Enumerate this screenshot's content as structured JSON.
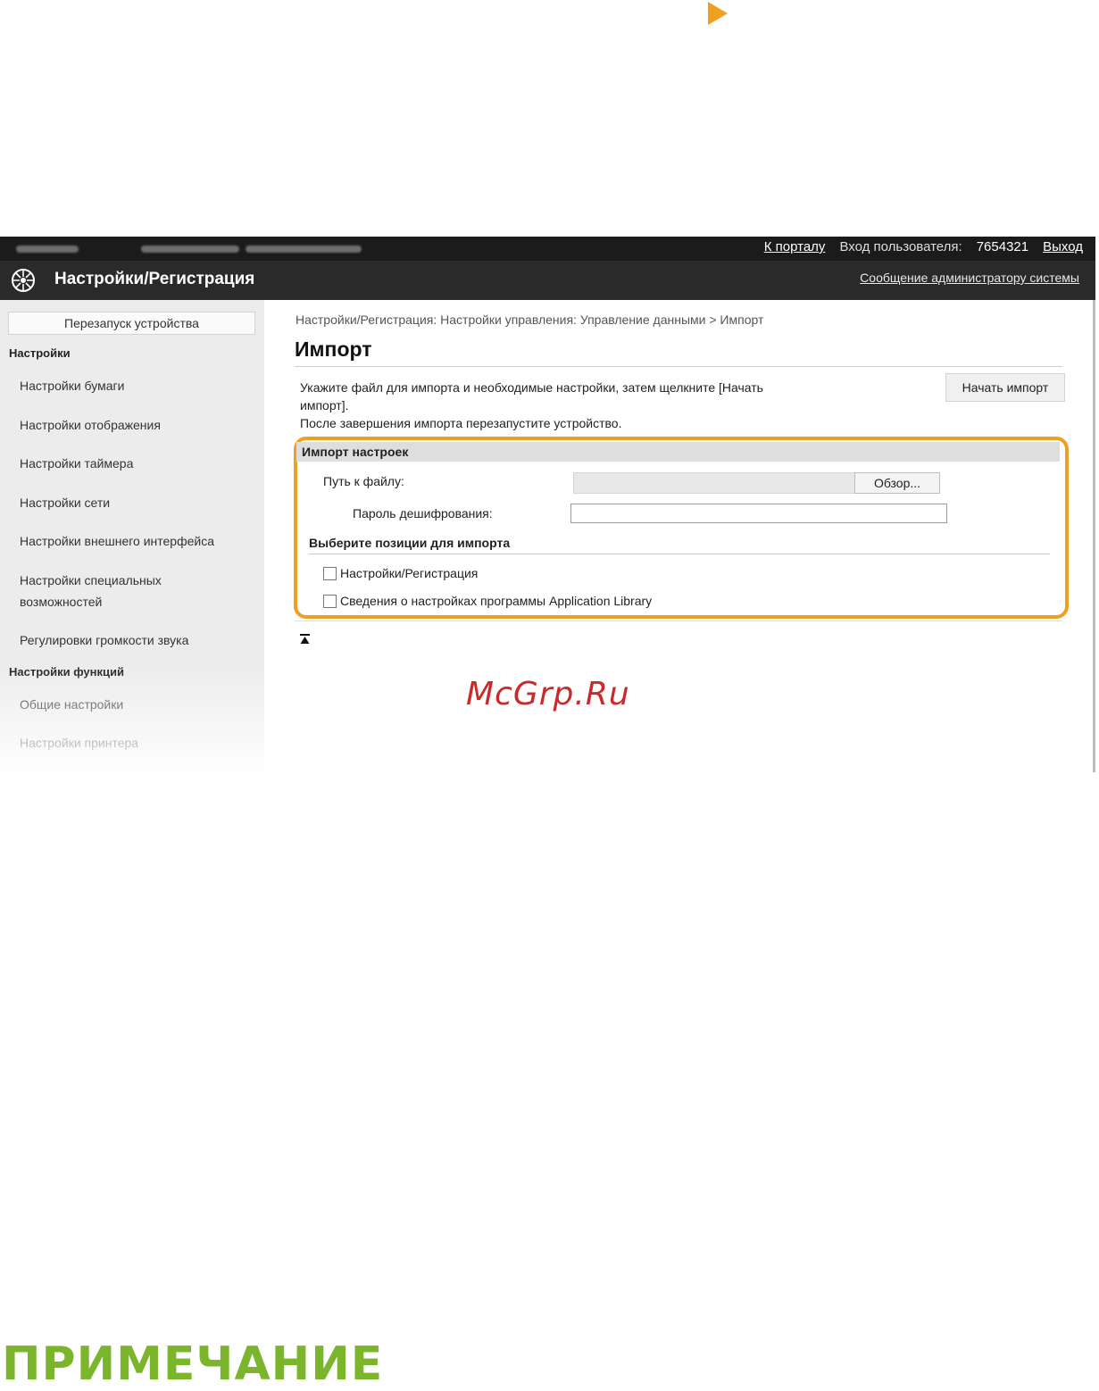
{
  "toplinks": {
    "portal": "К порталу",
    "login_label": "Вход пользователя:",
    "user_id": "7654321",
    "logout": "Выход"
  },
  "header": {
    "title": "Настройки/Регистрация",
    "admin_message": "Сообщение администратору системы"
  },
  "sidebar": {
    "restart_button": "Перезапуск устройства",
    "section1": "Настройки",
    "items1": [
      "Настройки бумаги",
      "Настройки отображения",
      "Настройки таймера",
      "Настройки сети",
      "Настройки внешнего интерфейса"
    ],
    "item_accessibility_line1": "Настройки специальных",
    "item_accessibility_line2": "возможностей",
    "item_volume": "Регулировки громкости звука",
    "section2": "Настройки функций",
    "items2": [
      "Общие настройки",
      "Настройки принтера"
    ]
  },
  "main": {
    "breadcrumb": "Настройки/Регистрация: Настройки управления: Управление данными > Импорт",
    "title": "Импорт",
    "instruction_line1": "Укажите файл для импорта и необходимые настройки, затем щелкните [Начать",
    "instruction_line2": "импорт].",
    "instruction_line3": "После завершения импорта перезапустите устройство.",
    "start_button": "Начать импорт",
    "section_title": "Импорт настроек",
    "file_path_label": "Путь к файлу:",
    "browse_button": "Обзор...",
    "password_label": "Пароль дешифрования:",
    "select_title": "Выберите позиции для импорта",
    "checkbox1": "Настройки/Регистрация",
    "checkbox2": "Сведения о настройках программы Application Library"
  },
  "watermark": "McGrp.Ru",
  "note_heading": "ПРИМЕЧАНИЕ",
  "colors": {
    "highlight": "#f0a020",
    "note_green": "#7ab52b",
    "watermark_red": "#cc2a2a"
  }
}
